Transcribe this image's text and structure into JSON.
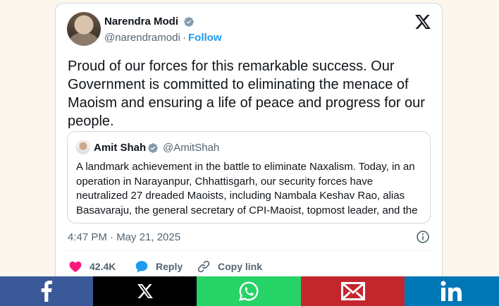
{
  "tweet": {
    "author_name": "Narendra Modi",
    "author_handle": "@narendramodi",
    "separator": "·",
    "follow_label": "Follow",
    "text": "Proud of our forces for this remarkable success. Our Government is committed to eliminating the menace of Maoism and ensuring a life of peace and progress for our people.",
    "timestamp": "4:47 PM · May 21, 2025"
  },
  "quote": {
    "author_name": "Amit Shah",
    "author_handle": "@AmitShah",
    "text": "A landmark achievement in the battle to eliminate Naxalism. Today, in an operation in Narayanpur, Chhattisgarh, our security forces have neutralized 27 dreaded Maoists, including Nambala Keshav Rao, alias Basavaraju, the general secretary of CPI-Maoist, topmost leader, and the"
  },
  "actions": {
    "like_count": "42.4K",
    "reply_label": "Reply",
    "copy_label": "Copy link"
  },
  "icons": {
    "verified": "verified-badge-icon",
    "x_logo": "x-logo-icon",
    "info": "info-icon",
    "like": "heart-icon",
    "reply": "speech-bubble-icon",
    "copy": "link-icon"
  },
  "share_bar": [
    {
      "network": "facebook",
      "color": "#3b5998"
    },
    {
      "network": "x",
      "color": "#000000"
    },
    {
      "network": "whatsapp",
      "color": "#25d366"
    },
    {
      "network": "email",
      "color": "#c4262e"
    },
    {
      "network": "linkedin",
      "color": "#0077b5"
    }
  ],
  "colors": {
    "accent": "#1d9bf0",
    "like": "#f91880",
    "text_primary": "#0f1419",
    "text_secondary": "#536471"
  }
}
